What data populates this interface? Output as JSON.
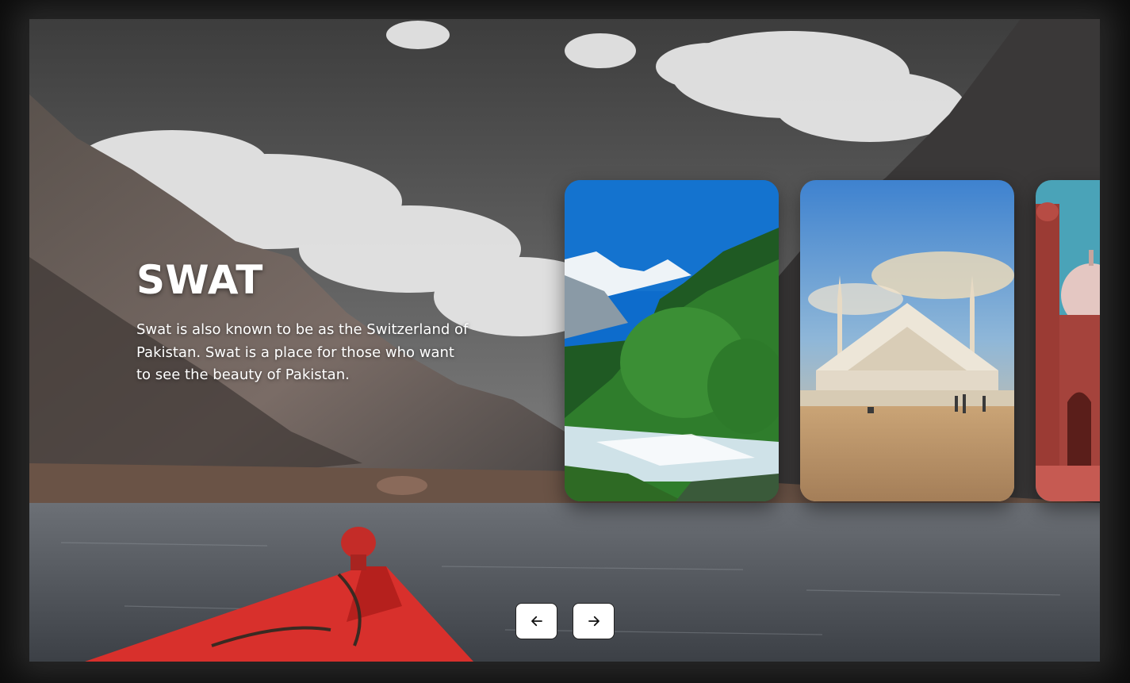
{
  "hero": {
    "title": "SWAT",
    "description": "Swat is also known to be as the Switzerland of Pakistan. Swat is a place for those who want to see the beauty of Pakistan."
  },
  "slides": [
    {
      "name": "mountain-river-valley"
    },
    {
      "name": "faisal-mosque"
    },
    {
      "name": "badshahi-mosque"
    }
  ],
  "navigation": {
    "prev_icon": "arrow-left-icon",
    "next_icon": "arrow-right-icon"
  },
  "colors": {
    "boat_red": "#d8302c",
    "water": "#4b4f55",
    "nav_button_bg": "#ffffff"
  }
}
